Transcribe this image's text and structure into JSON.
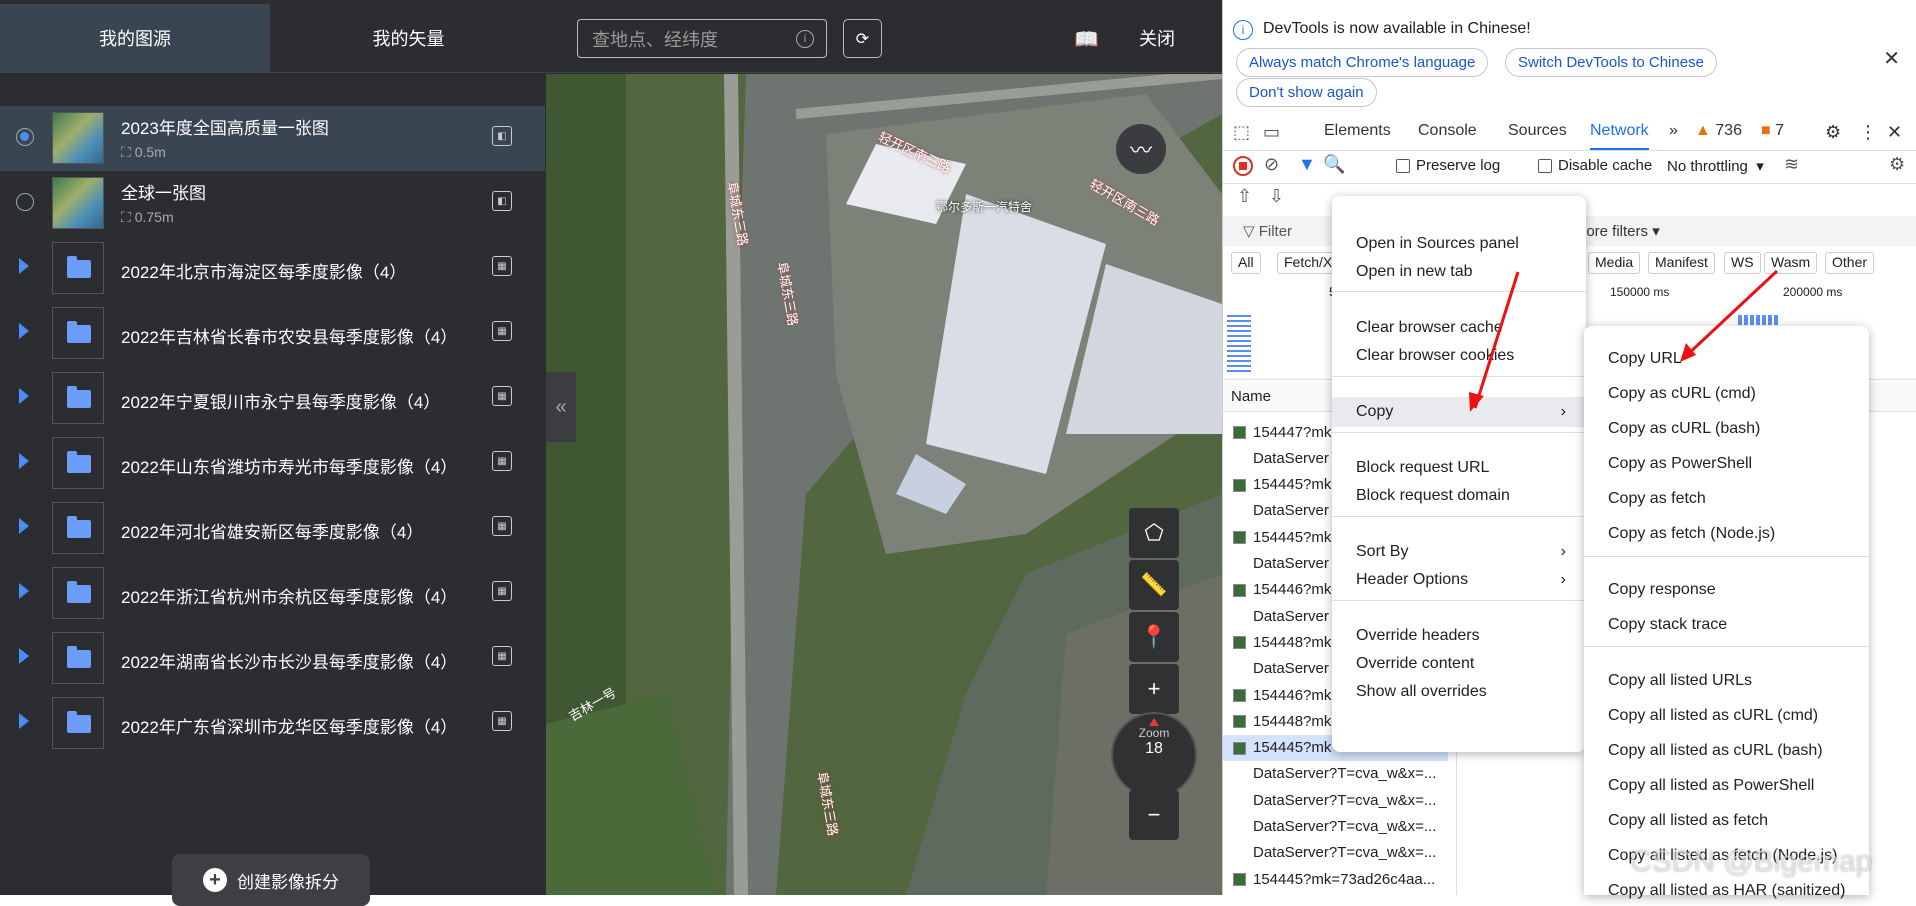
{
  "app": {
    "tab_my_imagery": "我的图源",
    "tab_my_vector": "我的矢量",
    "search_placeholder": "查地点、经纬度",
    "close_label": "关闭",
    "create_button": "创建影像拆分"
  },
  "imagery": [
    {
      "name": "2023年度全国高质量一张图",
      "res": "0.5m",
      "selected": true
    },
    {
      "name": "全球一张图",
      "res": "0.75m",
      "selected": false
    }
  ],
  "folders": [
    "2022年北京市海淀区每季度影像（4）",
    "2022年吉林省长春市农安县每季度影像（4）",
    "2022年宁夏银川市永宁县每季度影像（4）",
    "2022年山东省潍坊市寿光市每季度影像（4）",
    "2022年河北省雄安新区每季度影像（4）",
    "2022年浙江省杭州市余杭区每季度影像（4）",
    "2022年湖南省长沙市长沙县每季度影像（4）",
    "2022年广东省深圳市龙华区每季度影像（4）"
  ],
  "map": {
    "road1": "轻开区南三路",
    "road2": "轻开区南三路",
    "road3": "阜城东三路",
    "road4": "阜城东三路",
    "road5": "阜城东三路",
    "road6": "吉林一号",
    "label1": "鄂尔多斯一汽特舍",
    "zoom_label": "Zoom",
    "zoom_value": "18"
  },
  "devtools": {
    "banner": "DevTools is now available in Chinese!",
    "pill1": "Always match Chrome's language",
    "pill2": "Switch DevTools to Chinese",
    "pill3": "Don't show again",
    "tabs": [
      "Elements",
      "Console",
      "Sources",
      "Network"
    ],
    "warn_count": "736",
    "err_count": "7",
    "preserve_log": "Preserve log",
    "disable_cache": "Disable cache",
    "throttle": "No throttling",
    "filter": "Filter",
    "more_filters": "lore filters",
    "types": [
      "All",
      "Fetch/XH",
      "Media",
      "Manifest",
      "WS",
      "Wasm",
      "Other"
    ],
    "tl1": "5",
    "tl2": "150000 ms",
    "tl3": "200000 ms",
    "col_name": "Name",
    "rows": [
      "154447?mk",
      "DataServer",
      "154445?mk",
      "DataServer",
      "154445?mk",
      "DataServer",
      "154446?mk",
      "DataServer",
      "154448?mk",
      "DataServer",
      "154446?mk",
      "154448?mk",
      "154445?mk",
      "DataServer?T=cva_w&x=...",
      "DataServer?T=cva_w&x=...",
      "DataServer?T=cva_w&x=...",
      "DataServer?T=cva_w&x=...",
      "154445?mk=73ad26c4aa..."
    ]
  },
  "menu1": {
    "items": [
      "Open in Sources panel",
      "Open in new tab",
      "Clear browser cache",
      "Clear browser cookies",
      "Copy",
      "Block request URL",
      "Block request domain",
      "Sort By",
      "Header Options",
      "Override headers",
      "Override content",
      "Show all overrides"
    ]
  },
  "menu2": {
    "items": [
      "Copy URL",
      "Copy as cURL (cmd)",
      "Copy as cURL (bash)",
      "Copy as PowerShell",
      "Copy as fetch",
      "Copy as fetch (Node.js)",
      "Copy response",
      "Copy stack trace",
      "Copy all listed URLs",
      "Copy all listed as cURL (cmd)",
      "Copy all listed as cURL (bash)",
      "Copy all listed as PowerShell",
      "Copy all listed as fetch",
      "Copy all listed as fetch (Node.js)",
      "Copy all listed as HAR (sanitized)"
    ]
  },
  "watermark": "CSDN @Bigemap"
}
